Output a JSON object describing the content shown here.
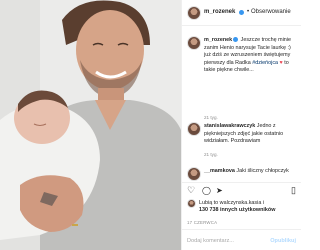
{
  "post": {
    "username": "m_rozenek",
    "follow_label": "Obserwowanie",
    "caption_user": "m_rozenek",
    "caption_text": " Jeszcze trochę minie zanim Henio narysuje Tacie laurkę :) już dziś ze wzruszeniem świętujemy pierwszy dla Radka ",
    "caption_tag": "#dzieńojca",
    "caption_heart": "♥",
    "caption_end": " to takie piękne chwile...",
    "time": "21 tyg."
  },
  "comments": [
    {
      "user": "stanislawakrawczyk",
      "text": " Jedno z piękniejszych zdjęć jakie ostatnio widziałam. Pozdrawiam",
      "meta": "21 tyg."
    },
    {
      "user": "__mamkova",
      "text": " Jaki śliczny chłopczyk",
      "meta": "21 tyg."
    }
  ],
  "actions": {
    "like_icon": "heart-outline-icon",
    "comment_icon": "comment-bubble-icon",
    "share_icon": "paper-plane-icon",
    "save_icon": "bookmark-icon",
    "like_glyph": "♡",
    "comment_glyph": "◯",
    "share_glyph": "➤",
    "save_glyph": "▯"
  },
  "likes": {
    "line1": "Lubią to walczynska.kasia i",
    "line2": "130 738 innych użytkowników"
  },
  "date": "17 CZERWCA",
  "add_comment": {
    "placeholder": "Dodaj komentarz...",
    "publish_label": "Opublikuj"
  },
  "colors": {
    "accent": "#3897f0",
    "heart": "#ed4956",
    "link": "#003569"
  }
}
